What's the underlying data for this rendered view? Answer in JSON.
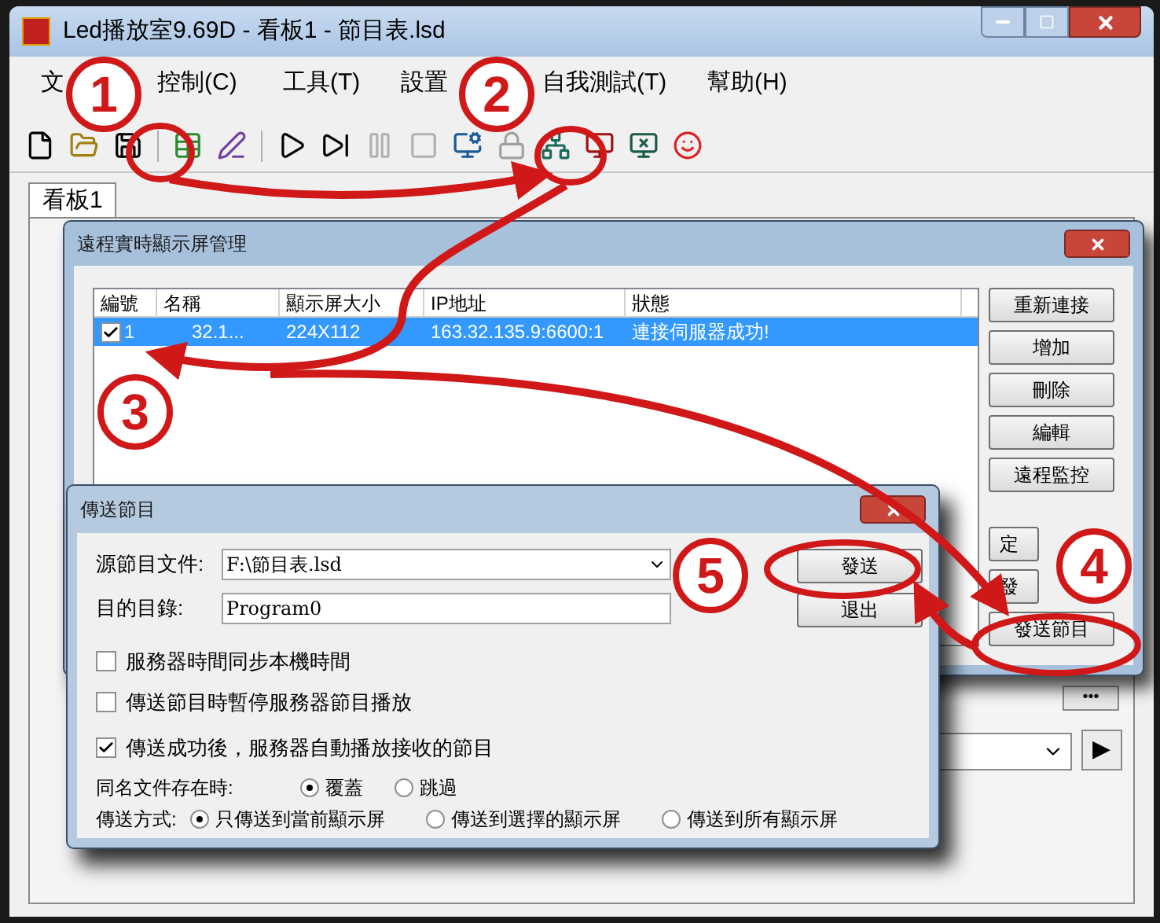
{
  "main_window": {
    "title": "Led播放室9.69D - 看板1 - 節目表.lsd"
  },
  "menu": [
    "文",
    "控制(C)",
    "工具(T)",
    "設置",
    "自我測試(T)",
    "幫助(H)"
  ],
  "tabs": [
    {
      "label": "看板1",
      "selected": true
    }
  ],
  "remote_dialog": {
    "title": "遠程實時顯示屏管理",
    "columns": [
      "編號",
      "名稱",
      "顯示屏大小",
      "IP地址",
      "狀態"
    ],
    "rows": [
      {
        "checked": true,
        "selected": true,
        "cells": [
          "1",
          "32.1...",
          "224X112",
          "163.32.135.9:6600:1",
          "連接伺服器成功!"
        ]
      }
    ],
    "buttons": [
      "重新連接",
      "增加",
      "刪除",
      "編輯",
      "遠程監控"
    ],
    "lower_buttons": [
      "定",
      "發",
      "發送節目"
    ]
  },
  "send_dialog": {
    "title": "傳送節目",
    "fields": [
      {
        "label": "源節目文件:",
        "value": "F:\\節目表.lsd",
        "kind": "combo"
      },
      {
        "label": "目的目錄:",
        "value": "Program0",
        "kind": "text"
      }
    ],
    "buttons": [
      "發送",
      "退出"
    ],
    "options": [
      {
        "label": "服務器時間同步本機時間",
        "checked": false
      },
      {
        "label": "傳送節目時暫停服務器節目播放",
        "checked": false
      },
      {
        "label": "傳送成功後，服務器自動播放接收的節目",
        "checked": true
      }
    ],
    "radio_groups": [
      {
        "label": "同名文件存在時:",
        "choices": [
          {
            "label": "覆蓋",
            "selected": true
          },
          {
            "label": "跳過",
            "selected": false
          }
        ]
      },
      {
        "label": "傳送方式:",
        "choices": [
          {
            "label": "只傳送到當前顯示屏",
            "selected": true
          },
          {
            "label": "傳送到選擇的顯示屏",
            "selected": false
          },
          {
            "label": "傳送到所有顯示屏",
            "selected": false
          }
        ]
      }
    ]
  },
  "background_controls": {
    "more_button": "•••",
    "play_button": "▶"
  },
  "callouts": [
    "1",
    "2",
    "3",
    "4",
    "5"
  ]
}
